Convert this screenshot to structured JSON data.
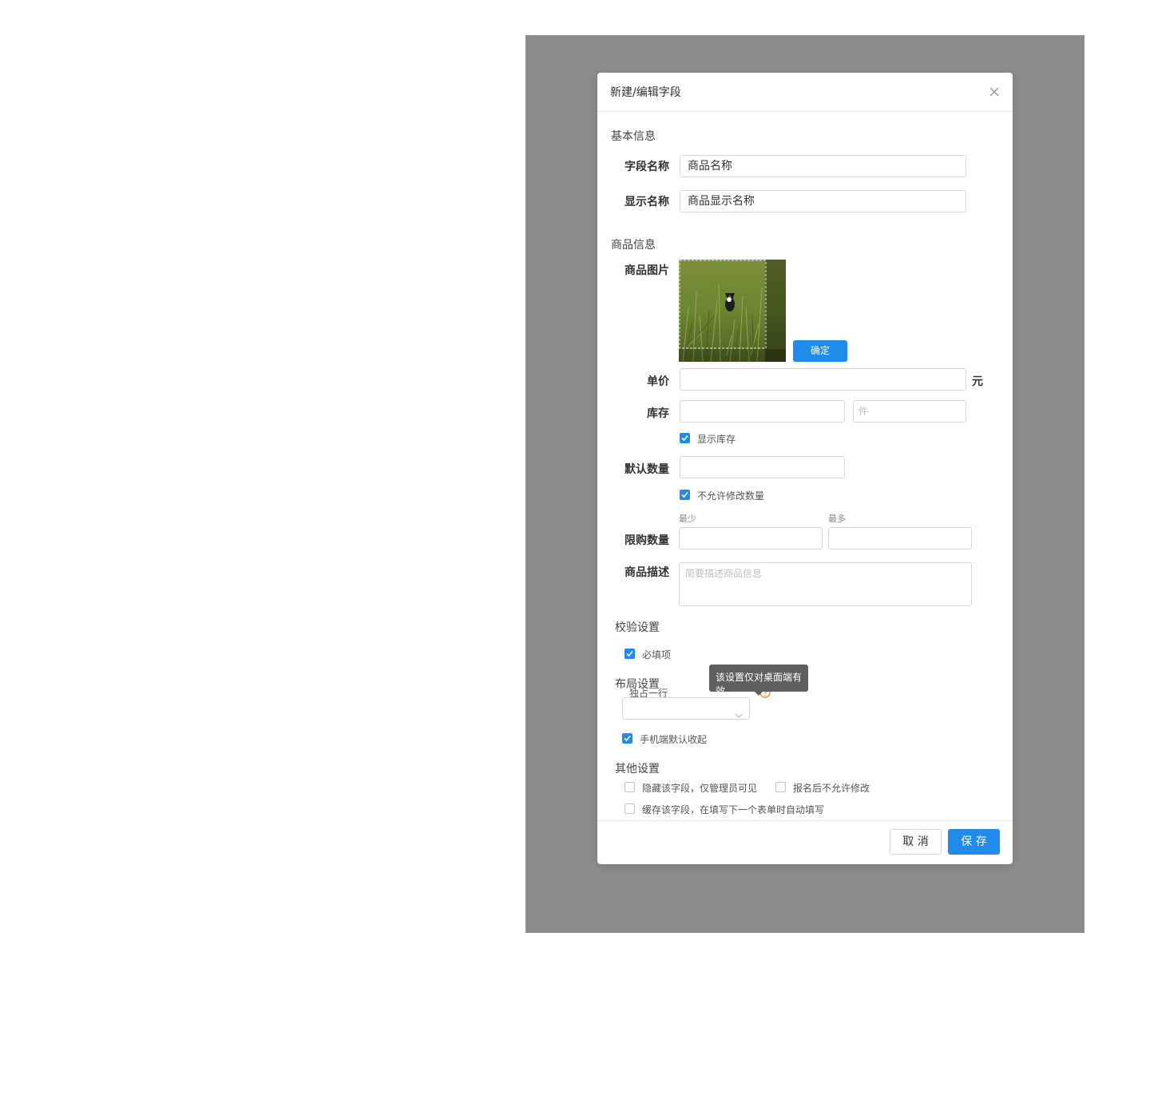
{
  "dialog": {
    "title": "新建/编辑字段"
  },
  "basic": {
    "section": "基本信息",
    "field_name_label": "字段名称",
    "field_name_value": "商品名称",
    "display_name_label": "显示名称",
    "display_name_value": "商品显示名称"
  },
  "product": {
    "section": "商品信息",
    "image_label": "商品图片",
    "confirm_button": "确定",
    "price_label": "单价",
    "price_unit": "元",
    "stock_label": "库存",
    "stock_unit_placeholder": "件",
    "show_stock_label": "显示库存",
    "show_stock_checked": true,
    "default_qty_label": "默认数量",
    "no_modify_qty_label": "不允许修改数量",
    "no_modify_qty_checked": true,
    "min_label": "最少",
    "max_label": "最多",
    "limit_label": "限购数量",
    "desc_label": "商品描述",
    "desc_placeholder": "简要描述商品信息"
  },
  "validation": {
    "section": "校验设置",
    "required_label": "必填项",
    "required_checked": true
  },
  "layout": {
    "section": "布局设置",
    "own_row_label": "独占一行",
    "tooltip": "该设置仅对桌面端有效",
    "mobile_collapse_label": "手机端默认收起",
    "mobile_collapse_checked": true
  },
  "other": {
    "section": "其他设置",
    "hide_field_label": "隐藏该字段，仅管理员可见",
    "no_modify_after_label": "报名后不允许修改",
    "cache_field_label": "缓存该字段，在填写下一个表单时自动填写"
  },
  "footer": {
    "cancel": "取 消",
    "save": "保 存"
  },
  "colors": {
    "primary": "#1f8ceb",
    "overlay": "#8c8c8c",
    "tooltip": "#5f5f5f",
    "help_icon": "#e8731a"
  },
  "icons": {
    "close": "close-icon",
    "check": "check-icon",
    "chevron": "chevron-down-icon",
    "help": "question-circle-icon"
  }
}
